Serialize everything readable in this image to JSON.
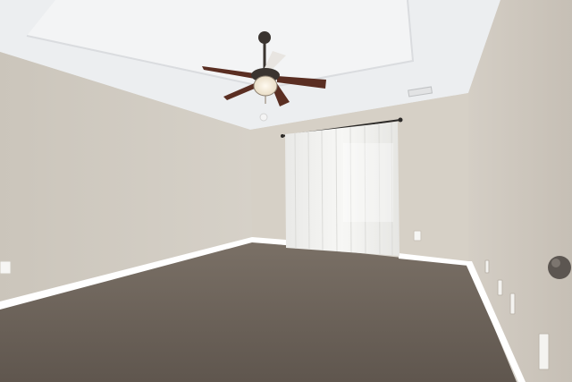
{
  "scene": {
    "description_colors": {
      "ceiling": "#eef0f2",
      "tray_ceiling": "#f4f5f6",
      "left_wall": "#d3cec5",
      "back_wall": "#d7d1c7",
      "right_wall": "#cfc9c0",
      "carpet": "#6e645b",
      "trim": "#ffffff",
      "curtain": "#f2f2f0",
      "fan_blade": "#5a2e22",
      "fan_metal": "#3a3430"
    }
  }
}
